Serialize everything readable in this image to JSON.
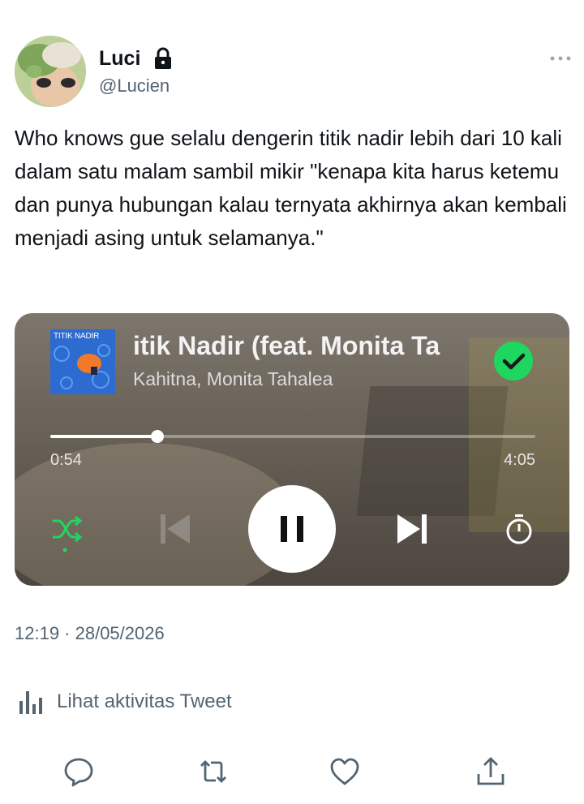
{
  "user": {
    "display_name": "Luci",
    "handle": "@Lucien",
    "locked": true
  },
  "tweet": {
    "text": "Who knows gue selalu dengerin titik nadir lebih dari 10 kali dalam satu malam sambil mikir \"kenapa kita harus ketemu dan punya hubungan kalau ternyata akhirnya akan kembali menjadi asing untuk selamanya.\"",
    "timestamp": "12:19 · 28/05/2026",
    "activity_label": "Lihat aktivitas Tweet"
  },
  "player": {
    "album_art_text": "TITIK NADIR",
    "song_title": "itik Nadir (feat. Monita Ta",
    "artist": "Kahitna, Monita Tahalea",
    "elapsed": "0:54",
    "total": "4:05",
    "progress_fraction": 0.22,
    "liked": true
  },
  "colors": {
    "accent_green": "#1ed760",
    "muted_text": "#536471",
    "primary_text": "#0f1419"
  },
  "icons": {
    "lock": "lock-icon",
    "more": "more-icon",
    "liked": "check-circle-icon",
    "shuffle": "shuffle-icon",
    "prev": "skip-previous-icon",
    "pause": "pause-icon",
    "next": "skip-next-icon",
    "timer": "sleep-timer-icon",
    "activity": "analytics-icon",
    "reply": "reply-icon",
    "retweet": "retweet-icon",
    "like": "heart-icon",
    "share": "share-icon"
  }
}
